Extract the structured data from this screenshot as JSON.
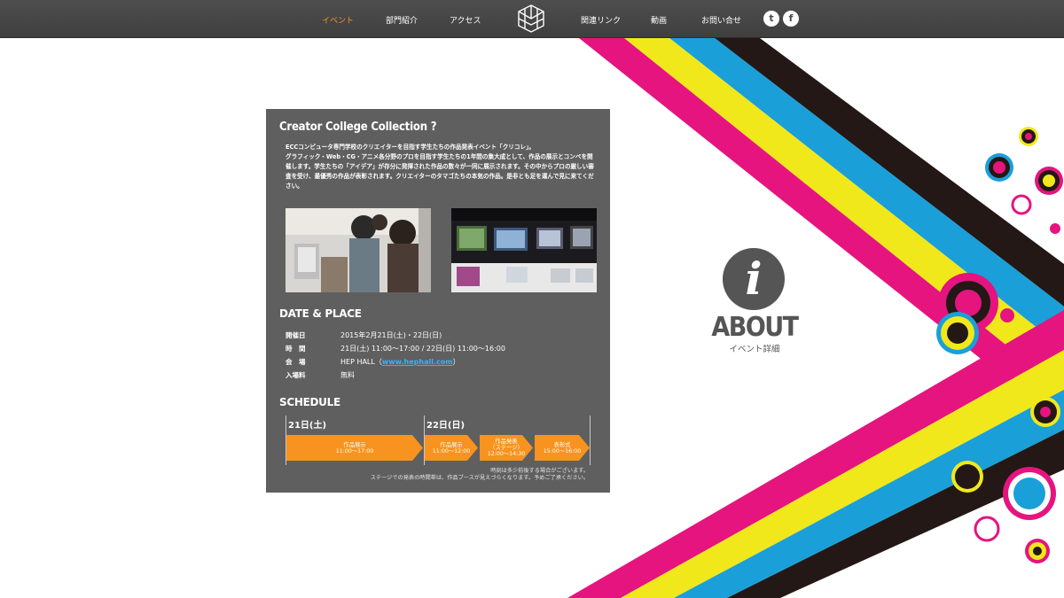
{
  "nav": {
    "items": [
      {
        "label": "イベント",
        "active": true
      },
      {
        "label": "部門紹介"
      },
      {
        "label": "アクセス"
      },
      {
        "label": "関連リンク"
      },
      {
        "label": "動画"
      },
      {
        "label": "お問い合せ"
      }
    ],
    "social": [
      {
        "icon": "twitter-icon",
        "glyph": "t"
      },
      {
        "icon": "facebook-icon",
        "glyph": "f"
      }
    ]
  },
  "panel": {
    "title": "Creator College Collection ?",
    "intro": [
      "ECCコンピュータ専門学校のクリエイターを目指す学生たちの作品発表イベント「クリコレ」。",
      "グラフィック・Web・CG・アニメ各分野のプロを目指す学生たちの1年間の集大成として、作品の展示とコンペを開催します。学生たちの「アイデア」が存分に発揮された作品の数々が一同に展示されます。その中からプロの厳しい審査を受け、最優秀の作品が表彰されます。クリエイターのタマゴたちの本気の作品。是非とも足を運んで見に来てください。"
    ],
    "date_place_heading": "DATE & PLACE",
    "info": [
      {
        "label": "開催日",
        "value": "2015年2月21日(土)・22日(日)"
      },
      {
        "label": "時　間",
        "value": "21日(土) 11:00〜17:00 / 22日(日) 11:00〜16:00"
      },
      {
        "label": "会　場",
        "value_prefix": "HEP HALL（",
        "link": "www.hephall.com",
        "value_suffix": "）"
      },
      {
        "label": "入場料",
        "value": "無料"
      }
    ],
    "schedule_heading": "SCHEDULE",
    "schedule": {
      "day1": "21日(土)",
      "day2": "22日(日)",
      "items": [
        {
          "line1": "作品展示",
          "line2": "11:00〜17:00"
        },
        {
          "line1": "作品展示",
          "line2": "11:00〜12:00"
        },
        {
          "line1": "作品発表",
          "line2": "（ステージ）",
          "line3": "12:00〜14:30"
        },
        {
          "line1": "表彰式",
          "line2": "15:00〜16:00"
        }
      ],
      "notes": [
        "時刻は多少前後する場合がございます。",
        "ステージでの発表の時間帯は、作品ブースが見えづらくなります。予めご了承ください。"
      ]
    }
  },
  "about": {
    "icon_letter": "i",
    "title": "ABOUT",
    "subtitle": "イベント詳細"
  },
  "colors": {
    "accent_orange": "#f7931e",
    "magenta": "#e5147e",
    "cyan": "#1a9fd9",
    "yellow": "#f0e81b",
    "black": "#231815",
    "nav_bg": "#474747",
    "panel_bg": "#5f5f5f"
  }
}
